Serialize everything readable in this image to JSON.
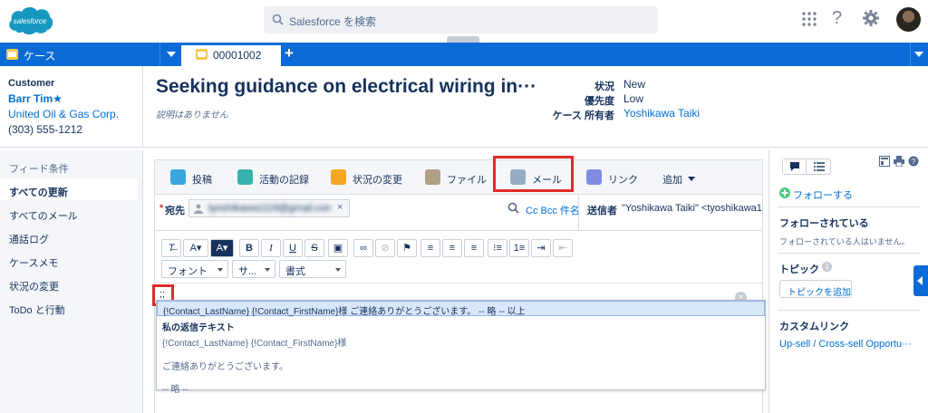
{
  "header": {
    "logo_text": "salesforce",
    "search_placeholder": "Salesforce を検索"
  },
  "tabs": {
    "case_label": "ケース",
    "record_tab_label": "00001002",
    "plus": "+"
  },
  "record": {
    "customer_label": "Customer",
    "contact_name": "Barr Tim★",
    "account": "United Oil & Gas Corp.",
    "phone": "(303) 555-1212",
    "subject": "Seeking guidance on electrical wiring in···",
    "description": "説明はありません",
    "fields": [
      {
        "key": "状況",
        "value": "New"
      },
      {
        "key": "優先度",
        "value": "Low"
      },
      {
        "key": "ケース 所有者",
        "value": "Yoshikawa Taiki"
      }
    ]
  },
  "feed": {
    "filter_label": "フィード条件",
    "items": [
      "すべての更新",
      "すべてのメール",
      "通話ログ",
      "ケースメモ",
      "状況の変更",
      "ToDo と行動"
    ],
    "selected_index": 0
  },
  "publisher": {
    "tabs": [
      {
        "label": "投稿",
        "icon": "post-icon",
        "color": "#3ba5de"
      },
      {
        "label": "活動の記録",
        "icon": "log-call-icon",
        "color": "#34b4ac"
      },
      {
        "label": "状況の変更",
        "icon": "lightning-icon",
        "color": "#f5a623"
      },
      {
        "label": "ファイル",
        "icon": "file-icon",
        "color": "#b0a087"
      },
      {
        "label": "メール",
        "icon": "email-icon",
        "color": "#95aec5"
      },
      {
        "label": "リンク",
        "icon": "link-icon",
        "color": "#7f8de1"
      },
      {
        "label": "追加",
        "icon": "chevron-down-icon",
        "color": "#16325c"
      }
    ],
    "to_label": "宛先",
    "to_required_mark": "*",
    "to_chip": "tyoshikawa1119@gmail.com",
    "cc_bcc_subject": "Cc Bcc 件名",
    "from_label": "送信者",
    "from_value": "\"Yoshikawa Taiki\" <tyoshikawa1",
    "font_label": "フォント",
    "size_label": "サ...",
    "format_label": "書式",
    "editor_text": ";;"
  },
  "suggest": {
    "highlight": "{!Contact_LastName} {!Contact_FirstName}様 ご連絡ありがとうございます。 -- 略 -- 以上",
    "title": "私の返信テキスト",
    "lines": [
      "{!Contact_LastName} {!Contact_FirstName}様",
      "",
      "ご連絡ありがとうございます。",
      "",
      "-- 略 --"
    ]
  },
  "sidebar": {
    "follow": "フォローする",
    "followed_title": "フォローされている",
    "followed_empty": "フォローされている人はいません。",
    "topics_title": "トピック",
    "add_topic": "トピックを追加",
    "custom_links_title": "カスタムリンク",
    "custom_link": "Up-sell / Cross-sell Opportu···"
  }
}
